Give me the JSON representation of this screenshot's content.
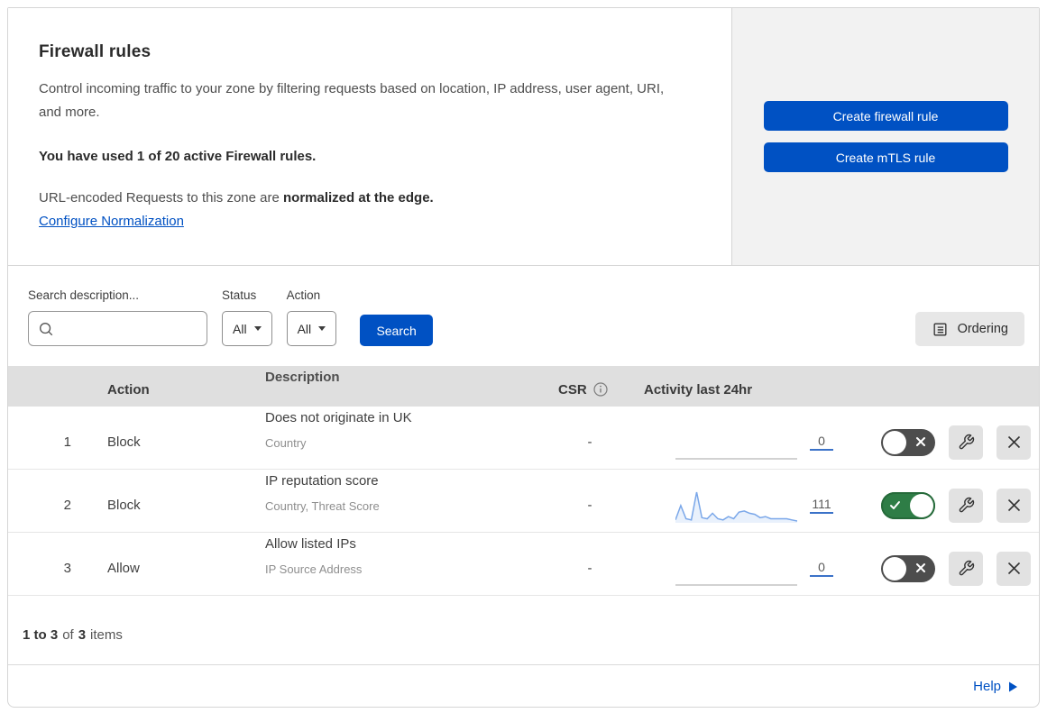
{
  "header": {
    "title": "Firewall rules",
    "description": "Control incoming traffic to your zone by filtering requests based on location, IP address, user agent, URI, and more.",
    "usage": "You have used 1 of 20 active Firewall rules.",
    "normalization_prefix": "URL-encoded Requests to this zone are ",
    "normalization_bold": "normalized at the edge.",
    "normalization_link": "Configure Normalization",
    "buttons": {
      "create_firewall": "Create firewall rule",
      "create_mtls": "Create mTLS rule"
    }
  },
  "filters": {
    "search_label": "Search description...",
    "search_value": "",
    "status_label": "Status",
    "status_value": "All",
    "action_label": "Action",
    "action_value": "All",
    "search_button": "Search",
    "ordering_button": "Ordering"
  },
  "table": {
    "columns": {
      "action": "Action",
      "description": "Description",
      "csr": "CSR",
      "activity": "Activity last 24hr"
    },
    "rows": [
      {
        "priority": "1",
        "action": "Block",
        "description": "Does not originate in UK",
        "fields": "Country",
        "csr": "-",
        "activity_count": "0",
        "enabled": false
      },
      {
        "priority": "2",
        "action": "Block",
        "description": "IP reputation score",
        "fields": "Country, Threat Score",
        "csr": "-",
        "activity_count": "111",
        "enabled": true
      },
      {
        "priority": "3",
        "action": "Allow",
        "description": "Allow listed IPs",
        "fields": "IP Source Address",
        "csr": "-",
        "activity_count": "0",
        "enabled": false
      }
    ]
  },
  "footer": {
    "range": "1 to 3",
    "of_text": "of",
    "total": "3",
    "items_text": "items",
    "help": "Help"
  },
  "colors": {
    "accent_blue": "#0051c3",
    "link_blue": "#0051c3",
    "toggle_on_green": "#2e7d46",
    "toggle_off_gray": "#4d4d4d",
    "panel_gray": "#f2f2f2",
    "table_header_gray": "#dfdfdf",
    "sparkline_blue": "#7aa7e9",
    "sparkline_fill": "#e9f1fc"
  },
  "chart_data": [
    {
      "type": "area",
      "series_label": "Activity last 24hr — rule 1 (Does not originate in UK)",
      "total": 0,
      "values": [
        0,
        0,
        0,
        0,
        0,
        0,
        0,
        0,
        0,
        0,
        0,
        0,
        0,
        0,
        0,
        0,
        0,
        0,
        0,
        0,
        0,
        0,
        0,
        0
      ]
    },
    {
      "type": "area",
      "series_label": "Activity last 24hr — rule 2 (IP reputation score)",
      "total": 111,
      "values": [
        1,
        14,
        2,
        1,
        26,
        3,
        2,
        7,
        2,
        1,
        4,
        2,
        8,
        9,
        7,
        6,
        3,
        4,
        2,
        2,
        2,
        2,
        1,
        0
      ]
    },
    {
      "type": "area",
      "series_label": "Activity last 24hr — rule 3 (Allow listed IPs)",
      "total": 0,
      "values": [
        0,
        0,
        0,
        0,
        0,
        0,
        0,
        0,
        0,
        0,
        0,
        0,
        0,
        0,
        0,
        0,
        0,
        0,
        0,
        0,
        0,
        0,
        0,
        0
      ]
    }
  ]
}
